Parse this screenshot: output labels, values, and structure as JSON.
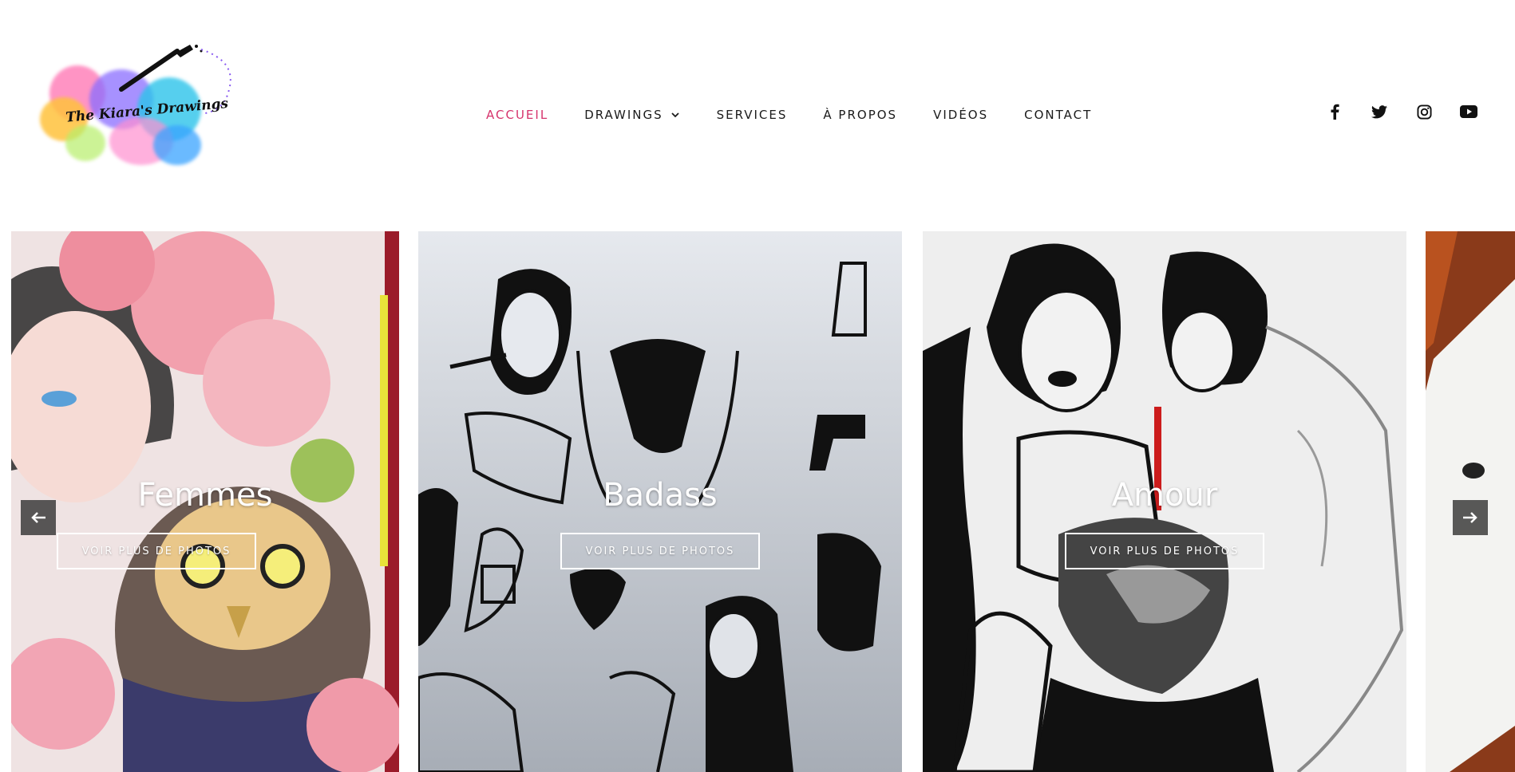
{
  "logo": {
    "text": "The Kiara's Drawings"
  },
  "nav": {
    "items": [
      {
        "label": "ACCUEIL",
        "active": true
      },
      {
        "label": "DRAWINGS",
        "has_dropdown": true
      },
      {
        "label": "SERVICES"
      },
      {
        "label": "À PROPOS"
      },
      {
        "label": "VIDÉOS"
      },
      {
        "label": "CONTACT"
      }
    ],
    "active_color": "#d6336c"
  },
  "social": [
    "facebook-icon",
    "twitter-icon",
    "instagram-icon",
    "youtube-icon"
  ],
  "carousel": {
    "slides": [
      {
        "title": "Femmes",
        "button": "VOIR PLUS DE PHOTOS"
      },
      {
        "title": "Badass",
        "button": "VOIR PLUS DE PHOTOS"
      },
      {
        "title": "Amour",
        "button": "VOIR PLUS DE PHOTOS"
      }
    ],
    "prev_icon": "arrow-left-icon",
    "next_icon": "arrow-right-icon"
  }
}
